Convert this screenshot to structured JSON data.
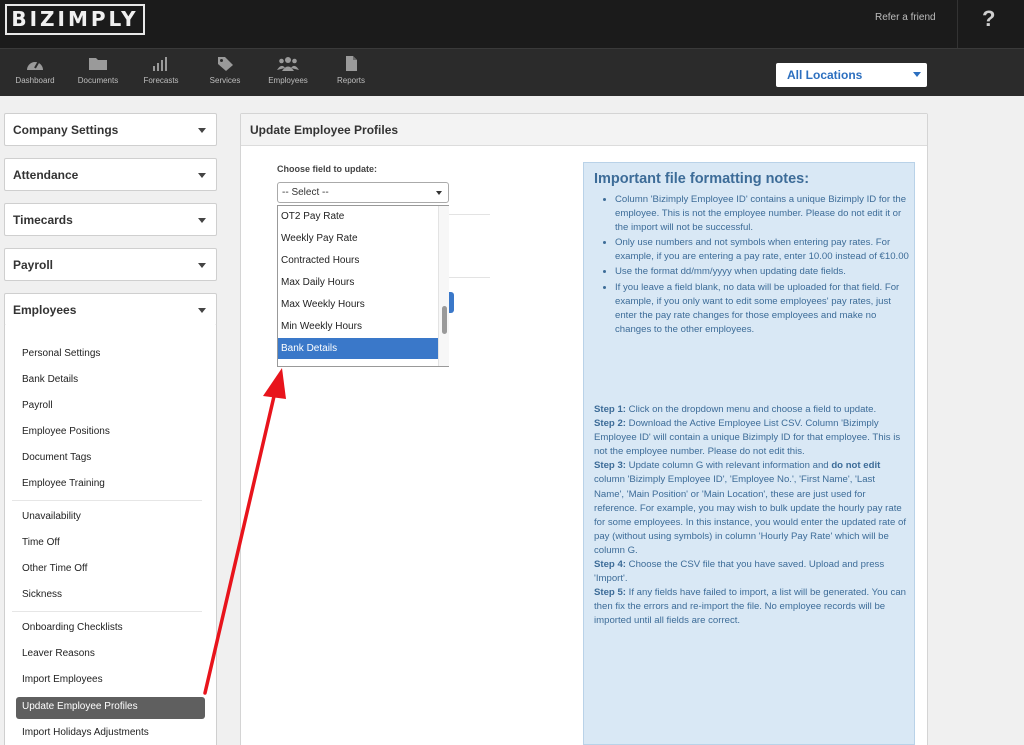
{
  "app": {
    "logo": "BIZIMPLY",
    "refer_link": "Refer a friend",
    "help": "?"
  },
  "nav": {
    "items": [
      {
        "label": "Dashboard",
        "icon": "gauge-icon"
      },
      {
        "label": "Documents",
        "icon": "folder-icon"
      },
      {
        "label": "Forecasts",
        "icon": "bars-icon"
      },
      {
        "label": "Services",
        "icon": "tag-icon"
      },
      {
        "label": "Employees",
        "icon": "people-icon"
      },
      {
        "label": "Reports",
        "icon": "file-icon"
      }
    ],
    "location_select": "All Locations"
  },
  "sidebar": {
    "panels": [
      {
        "label": "Company Settings"
      },
      {
        "label": "Attendance"
      },
      {
        "label": "Timecards"
      },
      {
        "label": "Payroll"
      },
      {
        "label": "Employees"
      }
    ],
    "items": [
      "Personal Settings",
      "Bank Details",
      "Payroll",
      "Employee Positions",
      "Document Tags",
      "Employee Training",
      "Unavailability",
      "Time Off",
      "Other Time Off",
      "Sickness",
      "Onboarding Checklists",
      "Leaver Reasons",
      "Import Employees",
      "Update Employee Profiles",
      "Import Holidays Adjustments"
    ],
    "active_item": "Update Employee Profiles"
  },
  "main": {
    "title": "Update Employee Profiles",
    "field_label": "Choose field to update:",
    "select_value": "-- Select --",
    "dropdown_options": [
      "OT2 Pay Rate",
      "Weekly Pay Rate",
      "Contracted Hours",
      "Max Daily Hours",
      "Max Weekly Hours",
      "Min Weekly Hours",
      "Bank Details"
    ],
    "selected_option": "Bank Details"
  },
  "notes": {
    "title": "Important file formatting notes:",
    "bullets": [
      "Column 'Bizimply Employee ID' contains a unique Bizimply ID for the employee. This is not the employee number. Please do not edit it or the import will not be successful.",
      "Only use numbers and not symbols when entering pay rates. For example, if you are entering a pay rate, enter 10.00 instead of €10.00",
      "Use the format dd/mm/yyyy when updating date fields.",
      "If you leave a field blank, no data will be uploaded for that field. For example, if you only want to edit some employees' pay rates, just enter the pay rate changes for those employees and make no changes to the other employees."
    ],
    "steps": {
      "s1_label": "Step 1:",
      "s1_text": " Click on the dropdown menu and choose a field to update.",
      "s2_label": "Step 2:",
      "s2_text": " Download the Active Employee List CSV. Column 'Bizimply Employee ID' will contain a unique Bizimply ID for that employee. This is not the employee number. Please do not edit this.",
      "s3_label": "Step 3:",
      "s3_text_a": " Update column G with relevant information and ",
      "s3_bold": "do not edit",
      "s3_text_b": " column 'Bizimply Employee ID', 'Employee No.', 'First Name', 'Last Name', 'Main Position' or 'Main Location', these are just used for reference. For example, you may wish to bulk update the hourly pay rate for some employees. In this instance, you would enter the updated rate of pay (without using symbols) in column 'Hourly Pay Rate' which will be column G.",
      "s4_label": "Step 4:",
      "s4_text": " Choose the CSV file that you have saved. Upload and press 'Import'.",
      "s5_label": "Step 5:",
      "s5_text": " If any fields have failed to import, a list will be generated. You can then fix the errors and re-import the file. No employee records will be imported until all fields are correct."
    }
  },
  "colors": {
    "accent": "#3a78c9",
    "arrow": "#e8141c",
    "notes_bg": "#d9e8f5"
  }
}
